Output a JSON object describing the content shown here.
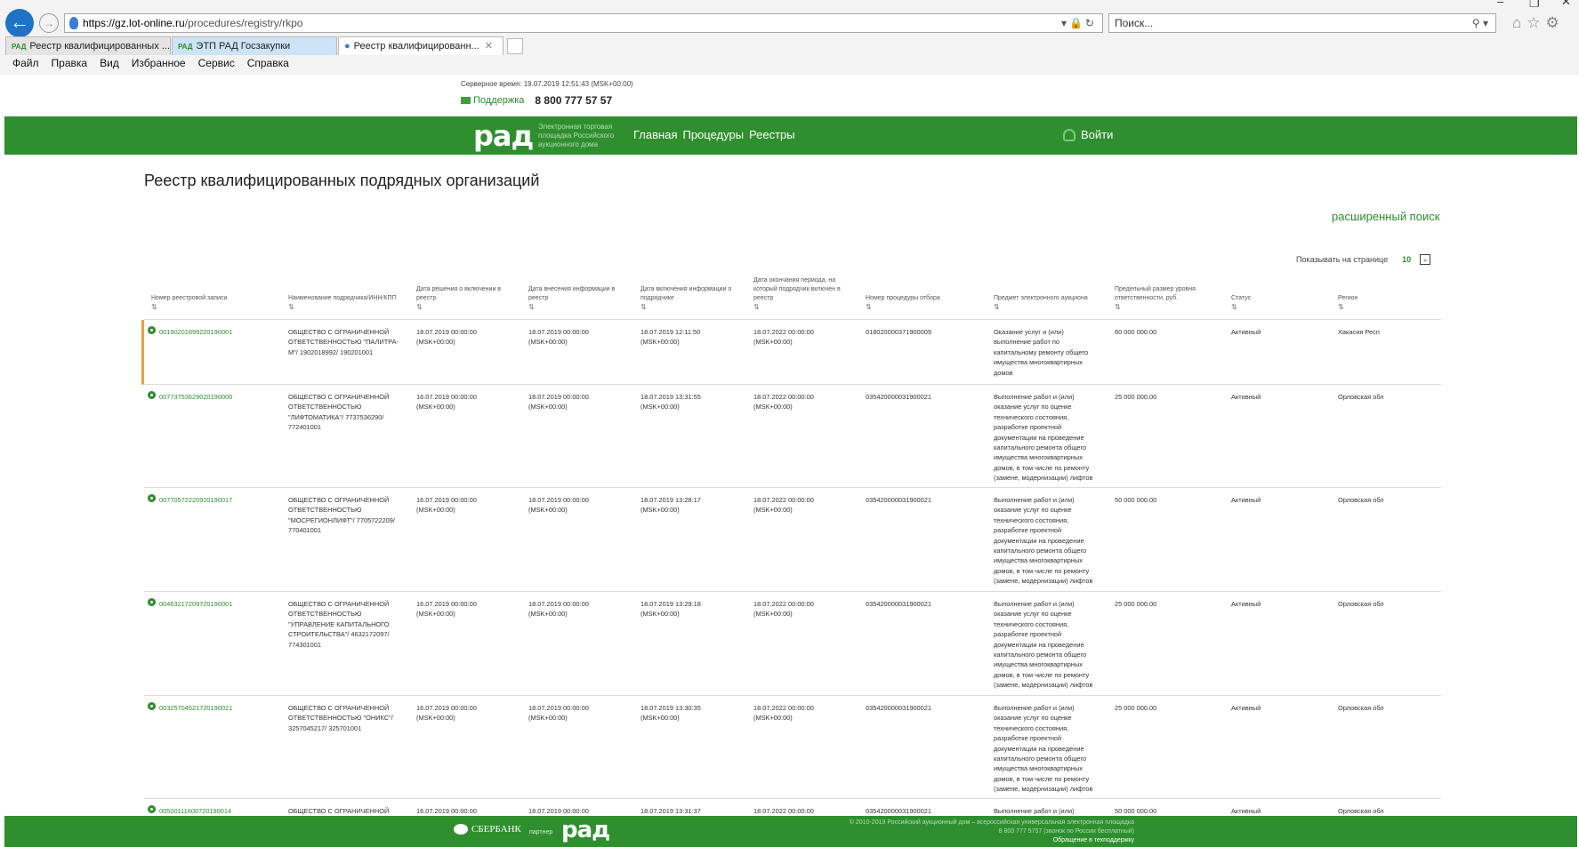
{
  "browser": {
    "url_host": "https://gz.lot-online.ru",
    "url_path": "/procedures/registry/rkpo",
    "search_placeholder": "Поиск...",
    "tabs": [
      {
        "label": "Реестр квалифицированных ...",
        "fav": "РАД"
      },
      {
        "label": "ЭТП РАД Госзакупки",
        "fav": "РАД"
      },
      {
        "label": "Реестр квалифицированн...",
        "fav": ""
      }
    ],
    "menu": [
      "Файл",
      "Правка",
      "Вид",
      "Избранное",
      "Сервис",
      "Справка"
    ]
  },
  "top": {
    "server_time": "Серверное время: 19.07.2019 12:51:43 (MSK+00:00)",
    "support_label": "Поддержка",
    "phone": "8 800 777 57 57"
  },
  "header": {
    "logo": "рад",
    "logo_sub": "Электронная торговая площадка Российского аукционного дома",
    "nav": [
      "Главная",
      "Процедуры",
      "Реестры"
    ],
    "login": "Войти"
  },
  "page": {
    "title": "Реестр квалифицированных подрядных организаций",
    "advanced_search": "расширенный поиск",
    "per_page_label": "Показывать на странице",
    "per_page_value": "10"
  },
  "table": {
    "columns": [
      "Номер реестровой записи",
      "Наименование подрядчика/ИНН/КПП",
      "Дата решения о включении в реестр",
      "Дата внесения информации в реестр",
      "Дата включения информации о подрядчике",
      "Дата окончания периода, на который подрядчик включен в реестр",
      "Номер процедуры отбора",
      "Предмет электронного аукциона",
      "Предельный размер уровня ответственности, руб.",
      "Статус",
      "Регион"
    ],
    "rows": [
      {
        "num": "00190201899220190001",
        "name": "ОБЩЕСТВО С ОГРАНИЧЕННОЙ ОТВЕТСТВЕННОСТЬЮ \"ПАЛИТРА-М\"/ 1902018992/ 190201001",
        "d1": "18.07.2019 00:00:00 (MSK+00:00)",
        "d2": "18.07.2019 00:00:00 (MSK+00:00)",
        "d3": "18.07.2019 12:11:50 (MSK+00:00)",
        "d4": "18.07.2022 00:00:00 (MSK+00:00)",
        "proc": "018020000371900009",
        "subject": "Оказание услуг и (или) выполнение работ по капитальному ремонту общего имущества многоквартирных домов",
        "amount": "60 000 000.00",
        "status": "Активный",
        "region": "Хакасия Респ"
      },
      {
        "num": "00773753629020190000",
        "name": "ОБЩЕСТВО С ОГРАНИЧЕННОЙ ОТВЕТСТВЕННОСТЬЮ \"ЛИФТОМАТИКА\"/ 7737536290/ 772401001",
        "d1": "16.07.2019 00:00:00 (MSK+00:00)",
        "d2": "18.07.2019 00:00:00 (MSK+00:00)",
        "d3": "18.07.2019 13:31:55 (MSK+00:00)",
        "d4": "18.07.2022 00:00:00 (MSK+00:00)",
        "proc": "035420000031900021",
        "subject": "Выполнение работ и (или) оказание услуг по оценке технического состояния, разработке проектной документации на проведение капитального ремонта общего имущества многоквартирных домов, в том числе по ремонту (замене, модернизации) лифтов",
        "amount": "25 000 000.00",
        "status": "Активный",
        "region": "Орловская обл"
      },
      {
        "num": "00770572220920190017",
        "name": "ОБЩЕСТВО С ОГРАНИЧЕННОЙ ОТВЕТСТВЕННОСТЬЮ \"МОСРЕГИОНЛИФТ\"/ 7705722209/ 770401001",
        "d1": "16.07.2019 00:00:00 (MSK+00:00)",
        "d2": "18.07.2019 00:00:00 (MSK+00:00)",
        "d3": "18.07.2019 13:28:17 (MSK+00:00)",
        "d4": "18.07.2022 00:00:00 (MSK+00:00)",
        "proc": "035420000031900021",
        "subject": "Выполнение работ и (или) оказание услуг по оценке технического состояния, разработке проектной документации на проведение капитального ремонта общего имущества многоквартирных домов, в том числе по ремонту (замене, модернизации) лифтов",
        "amount": "50 000 000.00",
        "status": "Активный",
        "region": "Орловская обл"
      },
      {
        "num": "00463217209720190001",
        "name": "ОБЩЕСТВО С ОГРАНИЧЕННОЙ ОТВЕТСТВЕННОСТЬЮ \"УПРАВЛЕНИЕ КАПИТАЛЬНОГО СТРОИТЕЛЬСТВА\"/ 4632172097/ 774301001",
        "d1": "16.07.2019 00:00:00 (MSK+00:00)",
        "d2": "18.07.2019 00:00:00 (MSK+00:00)",
        "d3": "18.07.2019 13:29:18 (MSK+00:00)",
        "d4": "18.07.2022 00:00:00 (MSK+00:00)",
        "proc": "035420000031900021",
        "subject": "Выполнение работ и (или) оказание услуг по оценке технического состояния, разработке проектной документации на проведение капитального ремонта общего имущества многоквартирных домов, в том числе по ремонту (замене, модернизации) лифтов",
        "amount": "25 000 000.00",
        "status": "Активный",
        "region": "Орловская обл"
      },
      {
        "num": "00325704521720190021",
        "name": "ОБЩЕСТВО С ОГРАНИЧЕННОЙ ОТВЕТСТВЕННОСТЬЮ \"ОНИКС\"/ 3257045217/ 325701001",
        "d1": "16.07.2019 00:00:00 (MSK+00:00)",
        "d2": "18.07.2019 00:00:00 (MSK+00:00)",
        "d3": "18.07.2019 13:30:35 (MSK+00:00)",
        "d4": "18.07.2022 00:00:00 (MSK+00:00)",
        "proc": "035420000031900021",
        "subject": "Выполнение работ и (или) оказание услуг по оценке технического состояния, разработке проектной документации на проведение капитального ремонта общего имущества многоквартирных домов, в том числе по ремонту (замене, модернизации) лифтов",
        "amount": "25 000 000.00",
        "status": "Активный",
        "region": "Орловская обл"
      },
      {
        "num": "00500111600720190014",
        "name": "ОБЩЕСТВО С ОГРАНИЧЕННОЙ",
        "d1": "16.07.2019 00:00:00",
        "d2": "18.07.2019 00:00:00",
        "d3": "18.07.2019 13:31:37",
        "d4": "18.07.2022 00:00:00",
        "proc": "035420000031900021",
        "subject": "Выполнение работ и (или)",
        "amount": "50 000 000.00",
        "status": "Активный",
        "region": "Орловская обл"
      }
    ]
  },
  "footer": {
    "sber": "СБЕРБАНК",
    "partner": "партнер",
    "logo": "рад",
    "copyright": "© 2010-2019 Российский аукционный дом – всероссийская универсальная электронная площадка",
    "phone_line": "8 800 777 5757 (звонок по России бесплатный)",
    "support_link": "Обращение в техподдержку"
  },
  "colors": {
    "brand_green": "#2f8f2f",
    "link_green": "#2d8c2d",
    "selected_row_marker": "#f0a030",
    "ie_back_button": "#1f73c7"
  }
}
